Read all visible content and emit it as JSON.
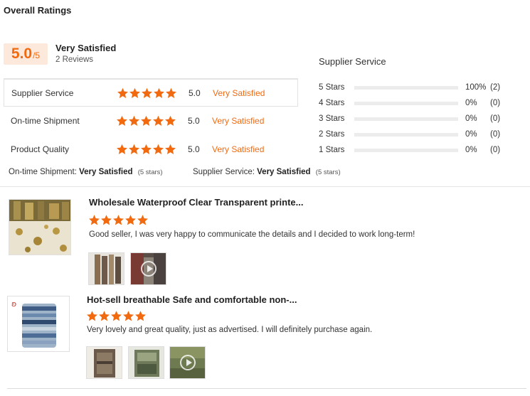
{
  "header": {
    "title": "Overall Ratings"
  },
  "overall": {
    "score": "5.0",
    "max": "/5",
    "verdict": "Very Satisfied",
    "reviews": "2 Reviews"
  },
  "ratings": [
    {
      "label": "Supplier Service",
      "value": "5.0",
      "verdict": "Very Satisfied",
      "stars": 5
    },
    {
      "label": "On-time Shipment",
      "value": "5.0",
      "verdict": "Very Satisfied",
      "stars": 5
    },
    {
      "label": "Product Quality",
      "value": "5.0",
      "verdict": "Very Satisfied",
      "stars": 5
    }
  ],
  "summary": [
    {
      "label": "On-time Shipment:",
      "verdict": "Very Satisfied",
      "note": "(5 stars)"
    },
    {
      "label": "Supplier Service:",
      "verdict": "Very Satisfied",
      "note": "(5 stars)"
    }
  ],
  "distribution": {
    "title": "Supplier Service",
    "rows": [
      {
        "label": "5  Stars",
        "fraction": 1.0,
        "pct": "100%",
        "count": "(2)"
      },
      {
        "label": "4  Stars",
        "fraction": 0,
        "pct": "0%",
        "count": "(0)"
      },
      {
        "label": "3  Stars",
        "fraction": 0,
        "pct": "0%",
        "count": "(0)"
      },
      {
        "label": "2  Stars",
        "fraction": 0,
        "pct": "0%",
        "count": "(0)"
      },
      {
        "label": "1  Stars",
        "fraction": 0,
        "pct": "0%",
        "count": "(0)"
      }
    ]
  },
  "reviews": [
    {
      "title": "Wholesale Waterproof Clear Transparent printe...",
      "stars": 5,
      "text": "Good seller, I was very happy to communicate the details and I decided to work long-term!"
    },
    {
      "title": "Hot-sell breathable Safe and comfortable non-...",
      "stars": 5,
      "text": "Very lovely and great quality, just as advertised. I will definitely purchase again."
    }
  ],
  "colors": {
    "accent": "#f26a10",
    "score_bg": "#fde9dc",
    "bar_track": "#ececec"
  }
}
